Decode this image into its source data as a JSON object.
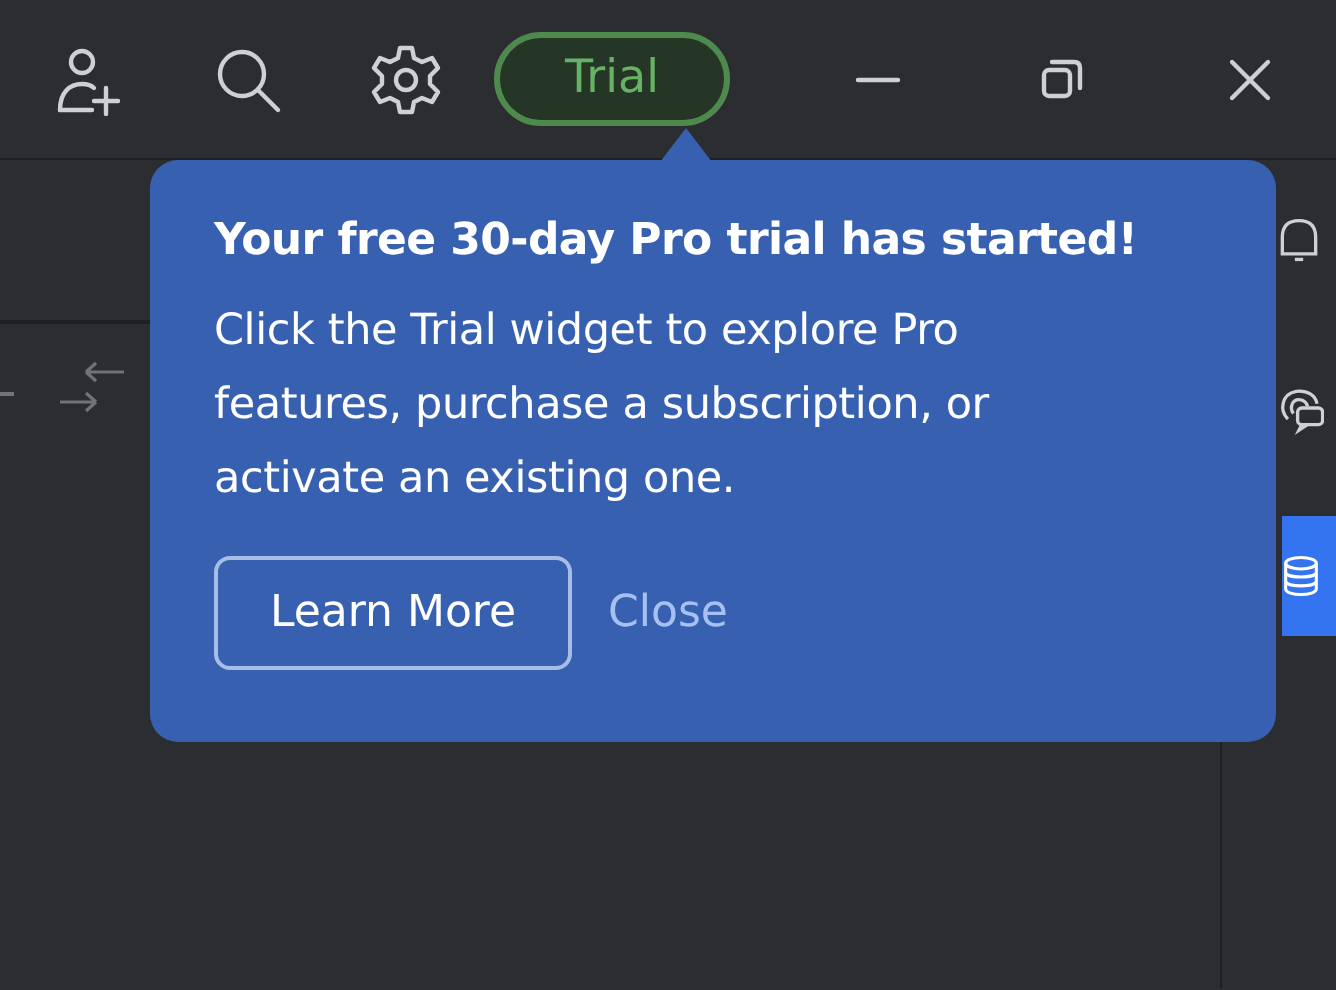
{
  "toolbar": {
    "trial_badge": "Trial"
  },
  "right_toolbar": [
    {
      "kind": "bell",
      "selected": false
    },
    {
      "kind": "chat",
      "selected": false
    },
    {
      "kind": "database",
      "selected": true
    }
  ],
  "popup": {
    "title": "Your free 30-day Pro trial has started!",
    "body": "Click the Trial widget to explore Pro features, purchase a subscription, or activate an existing one.",
    "buttons": [
      {
        "label": "Learn More",
        "kind": "outline"
      },
      {
        "label": "Close",
        "kind": "link"
      }
    ]
  }
}
